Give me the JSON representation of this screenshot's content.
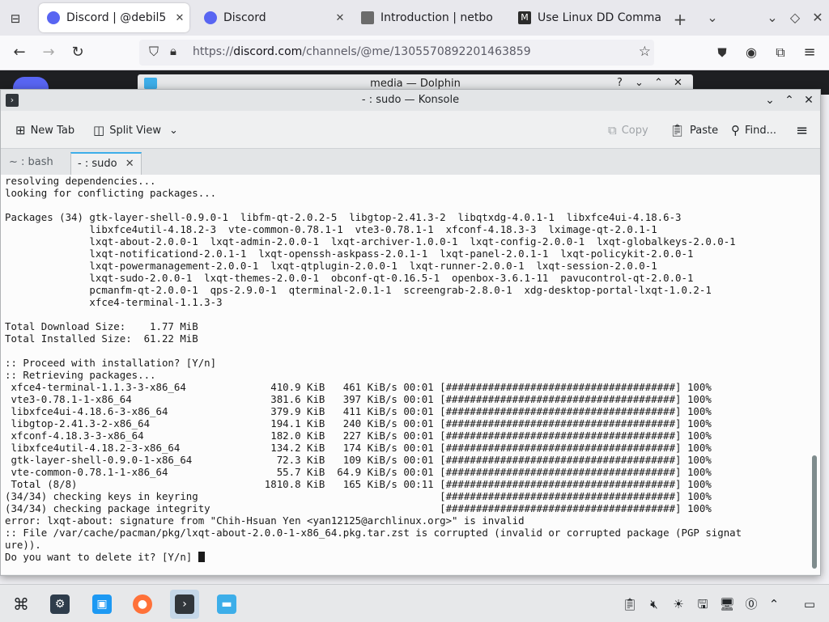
{
  "browser": {
    "tabs": [
      {
        "title": "Discord | @debil5",
        "fav_color": "#5865f2",
        "active": true
      },
      {
        "title": "Discord",
        "fav_color": "#5865f2",
        "active": false
      },
      {
        "title": "Introduction | netbo",
        "fav_color": "#6b6b6b",
        "active": false
      },
      {
        "title": "Use Linux DD Comma",
        "fav_color": "#2b2b2b",
        "fav_letter": "M",
        "active": false
      }
    ],
    "new_tab_symbol": "+",
    "url_prefix": "https://",
    "url_host": "discord.com",
    "url_path": "/channels/@me/1305570892201463859"
  },
  "dolphin": {
    "title": "media — Dolphin"
  },
  "konsole": {
    "title": "- : sudo — Konsole",
    "toolbar": {
      "new_tab": "New Tab",
      "split_view": "Split View",
      "copy": "Copy",
      "paste": "Paste",
      "find": "Find..."
    },
    "tabs": [
      {
        "label": "~ : bash"
      },
      {
        "label": "- : sudo"
      }
    ],
    "terminal": {
      "lines": [
        "resolving dependencies...",
        "looking for conflicting packages...",
        "",
        "Packages (34) gtk-layer-shell-0.9.0-1  libfm-qt-2.0.2-5  libgtop-2.41.3-2  libqtxdg-4.0.1-1  libxfce4ui-4.18.6-3",
        "              libxfce4util-4.18.2-3  vte-common-0.78.1-1  vte3-0.78.1-1  xfconf-4.18.3-3  lximage-qt-2.0.1-1",
        "              lxqt-about-2.0.0-1  lxqt-admin-2.0.0-1  lxqt-archiver-1.0.0-1  lxqt-config-2.0.0-1  lxqt-globalkeys-2.0.0-1",
        "              lxqt-notificationd-2.0.1-1  lxqt-openssh-askpass-2.0.1-1  lxqt-panel-2.0.1-1  lxqt-policykit-2.0.0-1",
        "              lxqt-powermanagement-2.0.0-1  lxqt-qtplugin-2.0.0-1  lxqt-runner-2.0.0-1  lxqt-session-2.0.0-1",
        "              lxqt-sudo-2.0.0-1  lxqt-themes-2.0.0-1  obconf-qt-0.16.5-1  openbox-3.6.1-11  pavucontrol-qt-2.0.0-1",
        "              pcmanfm-qt-2.0.0-1  qps-2.9.0-1  qterminal-2.0.1-1  screengrab-2.8.0-1  xdg-desktop-portal-lxqt-1.0.2-1",
        "              xfce4-terminal-1.1.3-3",
        "",
        "Total Download Size:    1.77 MiB",
        "Total Installed Size:  61.22 MiB",
        "",
        ":: Proceed with installation? [Y/n]",
        ":: Retrieving packages...",
        " xfce4-terminal-1.1.3-3-x86_64              410.9 KiB   461 KiB/s 00:01 [######################################] 100%",
        " vte3-0.78.1-1-x86_64                       381.6 KiB   397 KiB/s 00:01 [######################################] 100%",
        " libxfce4ui-4.18.6-3-x86_64                 379.9 KiB   411 KiB/s 00:01 [######################################] 100%",
        " libgtop-2.41.3-2-x86_64                    194.1 KiB   240 KiB/s 00:01 [######################################] 100%",
        " xfconf-4.18.3-3-x86_64                     182.0 KiB   227 KiB/s 00:01 [######################################] 100%",
        " libxfce4util-4.18.2-3-x86_64               134.2 KiB   174 KiB/s 00:01 [######################################] 100%",
        " gtk-layer-shell-0.9.0-1-x86_64              72.3 KiB   109 KiB/s 00:01 [######################################] 100%",
        " vte-common-0.78.1-1-x86_64                  55.7 KiB  64.9 KiB/s 00:01 [######################################] 100%",
        " Total (8/8)                               1810.8 KiB   165 KiB/s 00:11 [######################################] 100%",
        "(34/34) checking keys in keyring                                        [######################################] 100%",
        "(34/34) checking package integrity                                      [######################################] 100%",
        "error: lxqt-about: signature from \"Chih-Hsuan Yen <yan12125@archlinux.org>\" is invalid",
        ":: File /var/cache/pacman/pkg/lxqt-about-2.0.0-1-x86_64.pkg.tar.zst is corrupted (invalid or corrupted package (PGP signat",
        "ure))."
      ],
      "prompt": "Do you want to delete it? [Y/n] "
    }
  },
  "taskbar": {
    "apps": [
      {
        "name": "application-launcher",
        "color": "#2b3a4a"
      },
      {
        "name": "system-settings",
        "color": "#2f3d4c"
      },
      {
        "name": "discover",
        "color": "#1d99f3"
      },
      {
        "name": "firefox",
        "color": "#ff7139"
      },
      {
        "name": "konsole",
        "color": "#31363b"
      },
      {
        "name": "dolphin",
        "color": "#3daee9"
      }
    ]
  }
}
